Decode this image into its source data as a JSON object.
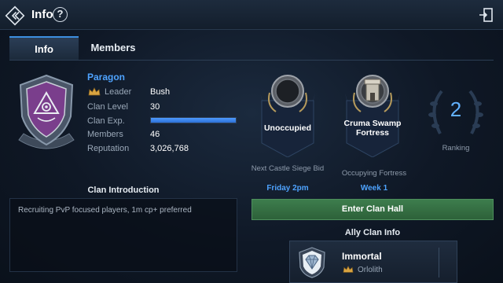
{
  "header": {
    "title": "Info",
    "help_symbol": "?",
    "back_icon": "back-arrow-icon",
    "exit_icon": "exit-door-icon"
  },
  "tabs": [
    {
      "label": "Info",
      "active": true
    },
    {
      "label": "Members",
      "active": false
    }
  ],
  "clan": {
    "name": "Paragon",
    "rows": [
      {
        "label": "Leader",
        "value": "Bush"
      },
      {
        "label": "Clan Level",
        "value": "30"
      },
      {
        "label": "Clan Exp.",
        "value": ""
      },
      {
        "label": "Members",
        "value": "46"
      },
      {
        "label": "Reputation",
        "value": "3,026,768"
      }
    ],
    "exp_fraction": 1.0
  },
  "introduction": {
    "title": "Clan Introduction",
    "text": "Recruiting PvP focused players,  1m cp+ preferred"
  },
  "castle_siege": {
    "status": "Unoccupied",
    "caption": "Next Castle Siege Bid",
    "value": "Friday 2pm"
  },
  "fortress": {
    "name": "Cruma Swamp Fortress",
    "caption": "Occupying Fortress",
    "value": "Week 1"
  },
  "ranking": {
    "value": "2",
    "caption": "Ranking"
  },
  "enter_hall_label": "Enter Clan Hall",
  "ally": {
    "title": "Ally Clan Info",
    "name": "Immortal",
    "leader": "Orlolith"
  },
  "colors": {
    "accent_blue": "#4ea3ff",
    "enter_green": "#3d7d4d",
    "emblem_purple": "#7a3e8c",
    "gold": "#d9a441"
  }
}
